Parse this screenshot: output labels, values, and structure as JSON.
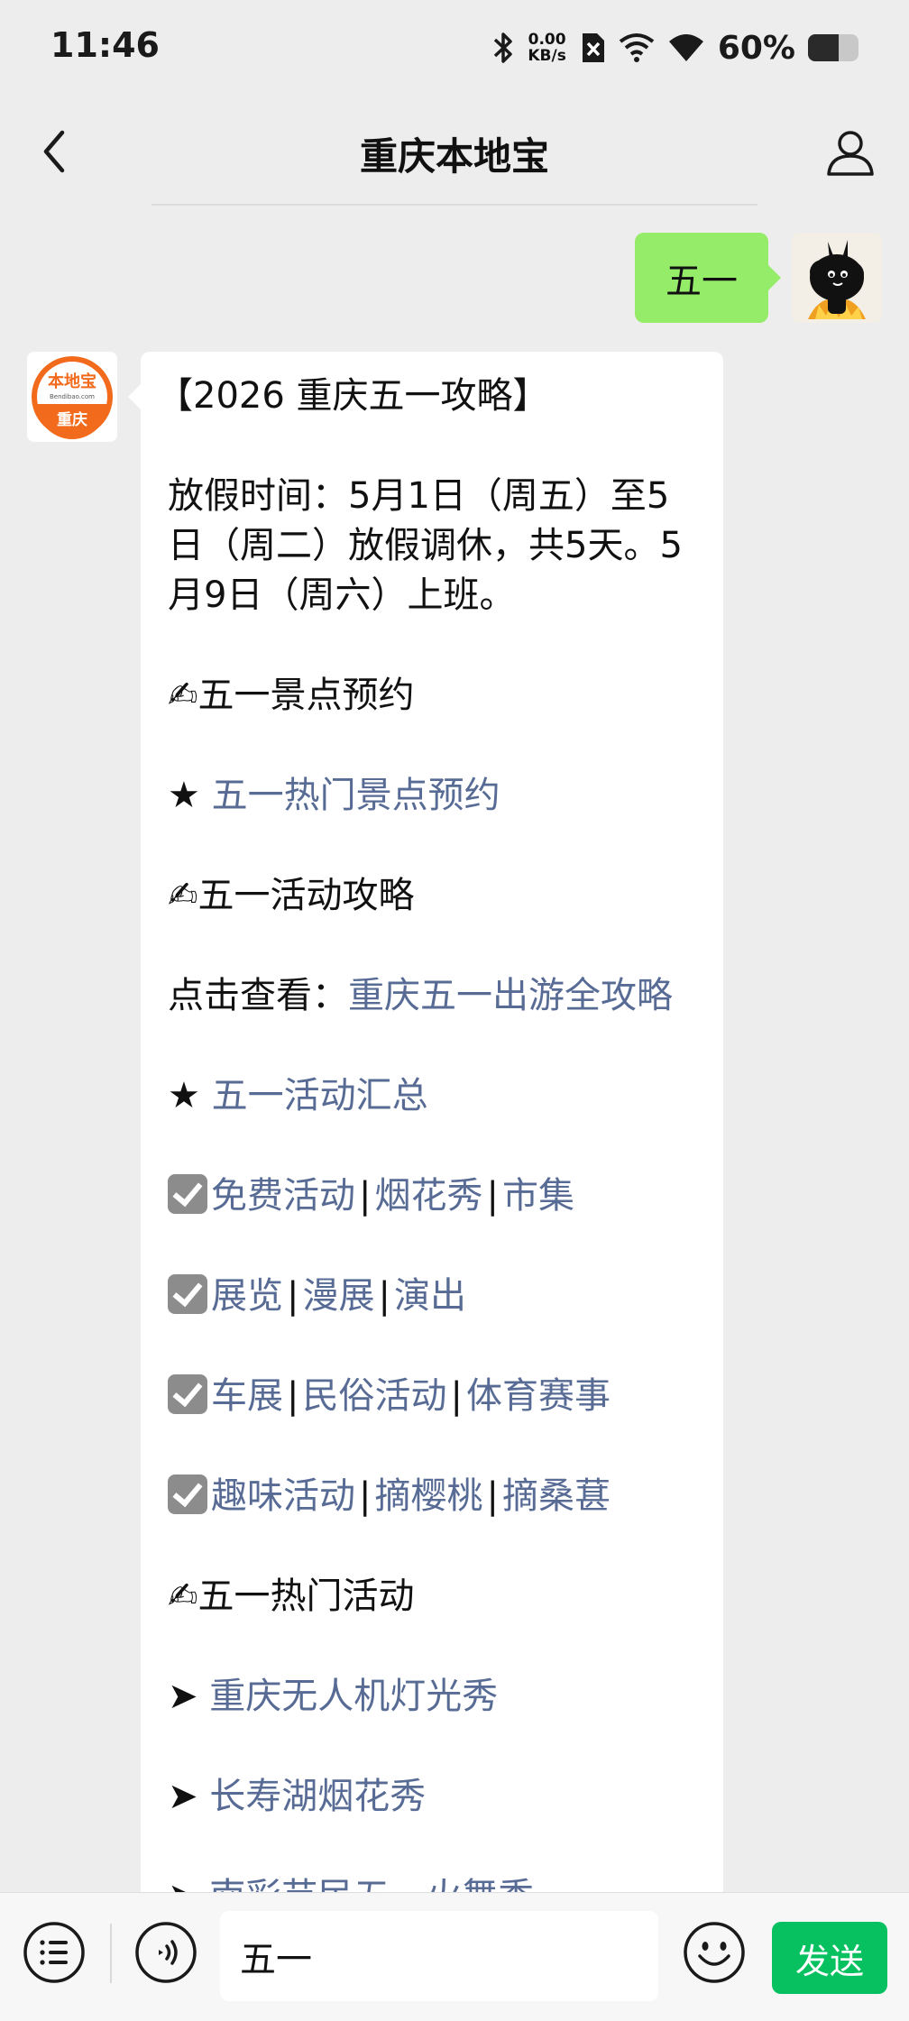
{
  "status_bar": {
    "time": "11:46",
    "net_speed_value": "0.00",
    "net_speed_unit": "KB/s",
    "battery_percent": "60%",
    "battery_level": 0.6
  },
  "nav": {
    "title": "重庆本地宝"
  },
  "my_message": {
    "text": "五一"
  },
  "bot_avatar": {
    "logo_text": "本地宝",
    "logo_url": "Bendibao.com",
    "city": "重庆"
  },
  "bot_message": {
    "header": "【2026 重庆五一攻略】",
    "holiday_text": "放假时间：5月1日（周五）至5日（周二）放假调休，共5天。5月9日（周六）上班。",
    "sec1_icon": "✍",
    "sec1_title": "五一景点预约",
    "star": "★",
    "hot_spots_link": "五一热门景点预约",
    "sec2_title": "五一活动攻略",
    "click_view": "点击查看：",
    "guide_link": "重庆五一出游全攻略",
    "summary_link": "五一活动汇总",
    "row1": [
      "免费活动",
      "烟花秀",
      "市集"
    ],
    "row2": [
      "展览",
      "漫展",
      "演出"
    ],
    "row3": [
      "车展",
      "民俗活动",
      "体育赛事"
    ],
    "row4": [
      "趣味活动",
      "摘樱桃",
      "摘桑葚"
    ],
    "separator": "|",
    "sec3_title": "五一热门活动",
    "arrow": "➤",
    "hot1": "重庆无人机灯光秀",
    "hot2": "长寿湖烟花秀",
    "hot3": "南彩苗民五一火舞秀"
  },
  "input_bar": {
    "text": "五一",
    "send_label": "发送"
  }
}
